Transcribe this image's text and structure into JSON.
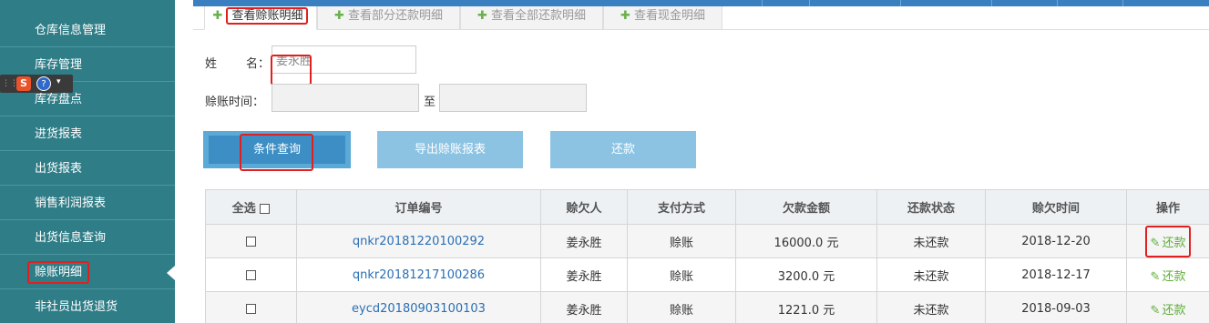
{
  "sidebar": {
    "items": [
      {
        "label": "仓库信息管理"
      },
      {
        "label": "库存管理"
      },
      {
        "label": "库存盘点"
      },
      {
        "label": "进货报表"
      },
      {
        "label": "出货报表"
      },
      {
        "label": "销售利润报表"
      },
      {
        "label": "出货信息查询"
      },
      {
        "label": "赊账明细"
      },
      {
        "label": "非社员出货退货"
      }
    ]
  },
  "ime": {
    "logo": "S",
    "help": "?",
    "drop": "▾",
    "grip": "⋮⋮"
  },
  "tabs": [
    {
      "label": "查看赊账明细",
      "plus": "✚"
    },
    {
      "label": "查看部分还款明细",
      "plus": "✚"
    },
    {
      "label": "查看全部还款明细",
      "plus": "✚"
    },
    {
      "label": "查看现金明细",
      "plus": "✚"
    }
  ],
  "form": {
    "name_label_1": "姓",
    "name_label_2": "名：",
    "name_value": "姜永胜",
    "time_label": "赊账时间：",
    "to_label": "至",
    "time_start": "",
    "time_end": ""
  },
  "buttons": {
    "query": "条件查询",
    "export": "导出赊账报表",
    "repay": "还款"
  },
  "table": {
    "headers": [
      "全选",
      "订单编号",
      "赊欠人",
      "支付方式",
      "欠款金额",
      "还款状态",
      "赊欠时间",
      "操作"
    ],
    "rows": [
      {
        "order": "qnkr20181220100292",
        "person": "姜永胜",
        "pay": "赊账",
        "amount": "16000.0 元",
        "status": "未还款",
        "date": "2018-12-20",
        "action": "还款"
      },
      {
        "order": "qnkr20181217100286",
        "person": "姜永胜",
        "pay": "赊账",
        "amount": "3200.0 元",
        "status": "未还款",
        "date": "2018-12-17",
        "action": "还款"
      },
      {
        "order": "eycd20180903100103",
        "person": "姜永胜",
        "pay": "赊账",
        "amount": "1221.0 元",
        "status": "未还款",
        "date": "2018-09-03",
        "action": "还款"
      }
    ]
  },
  "colors": {
    "sidebar": "#2f7d87",
    "accent": "#5ba9d6",
    "link": "#2a6fb5",
    "action": "#5fae3a",
    "highlight": "#e02020"
  }
}
